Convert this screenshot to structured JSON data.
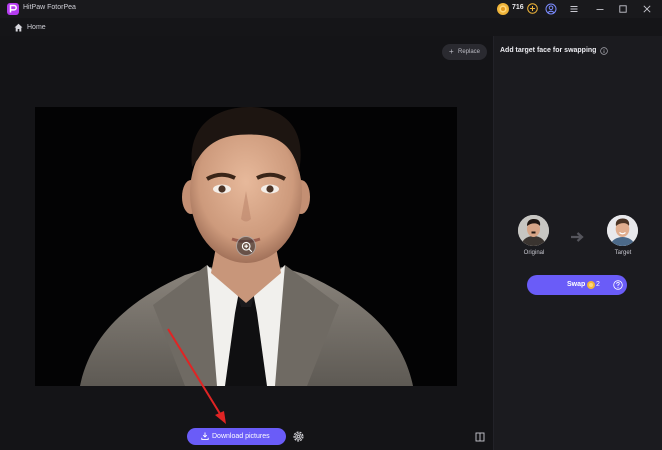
{
  "window": {
    "title": "HitPaw FotorPea",
    "credits": "716",
    "controls": [
      "add-credits",
      "account",
      "menu",
      "minimize",
      "maximize",
      "close"
    ]
  },
  "nav": {
    "home_label": "Home"
  },
  "main": {
    "replace_label": "Replace",
    "download_label": "Download pictures"
  },
  "panel": {
    "title": "Add target face for swapping",
    "original_label": "Original",
    "target_label": "Target",
    "swap_label": "Swap",
    "swap_cost": "2"
  },
  "colors": {
    "accent": "#6a5cf8",
    "coin": "#f0b53a",
    "annotation_arrow": "#e02424"
  }
}
